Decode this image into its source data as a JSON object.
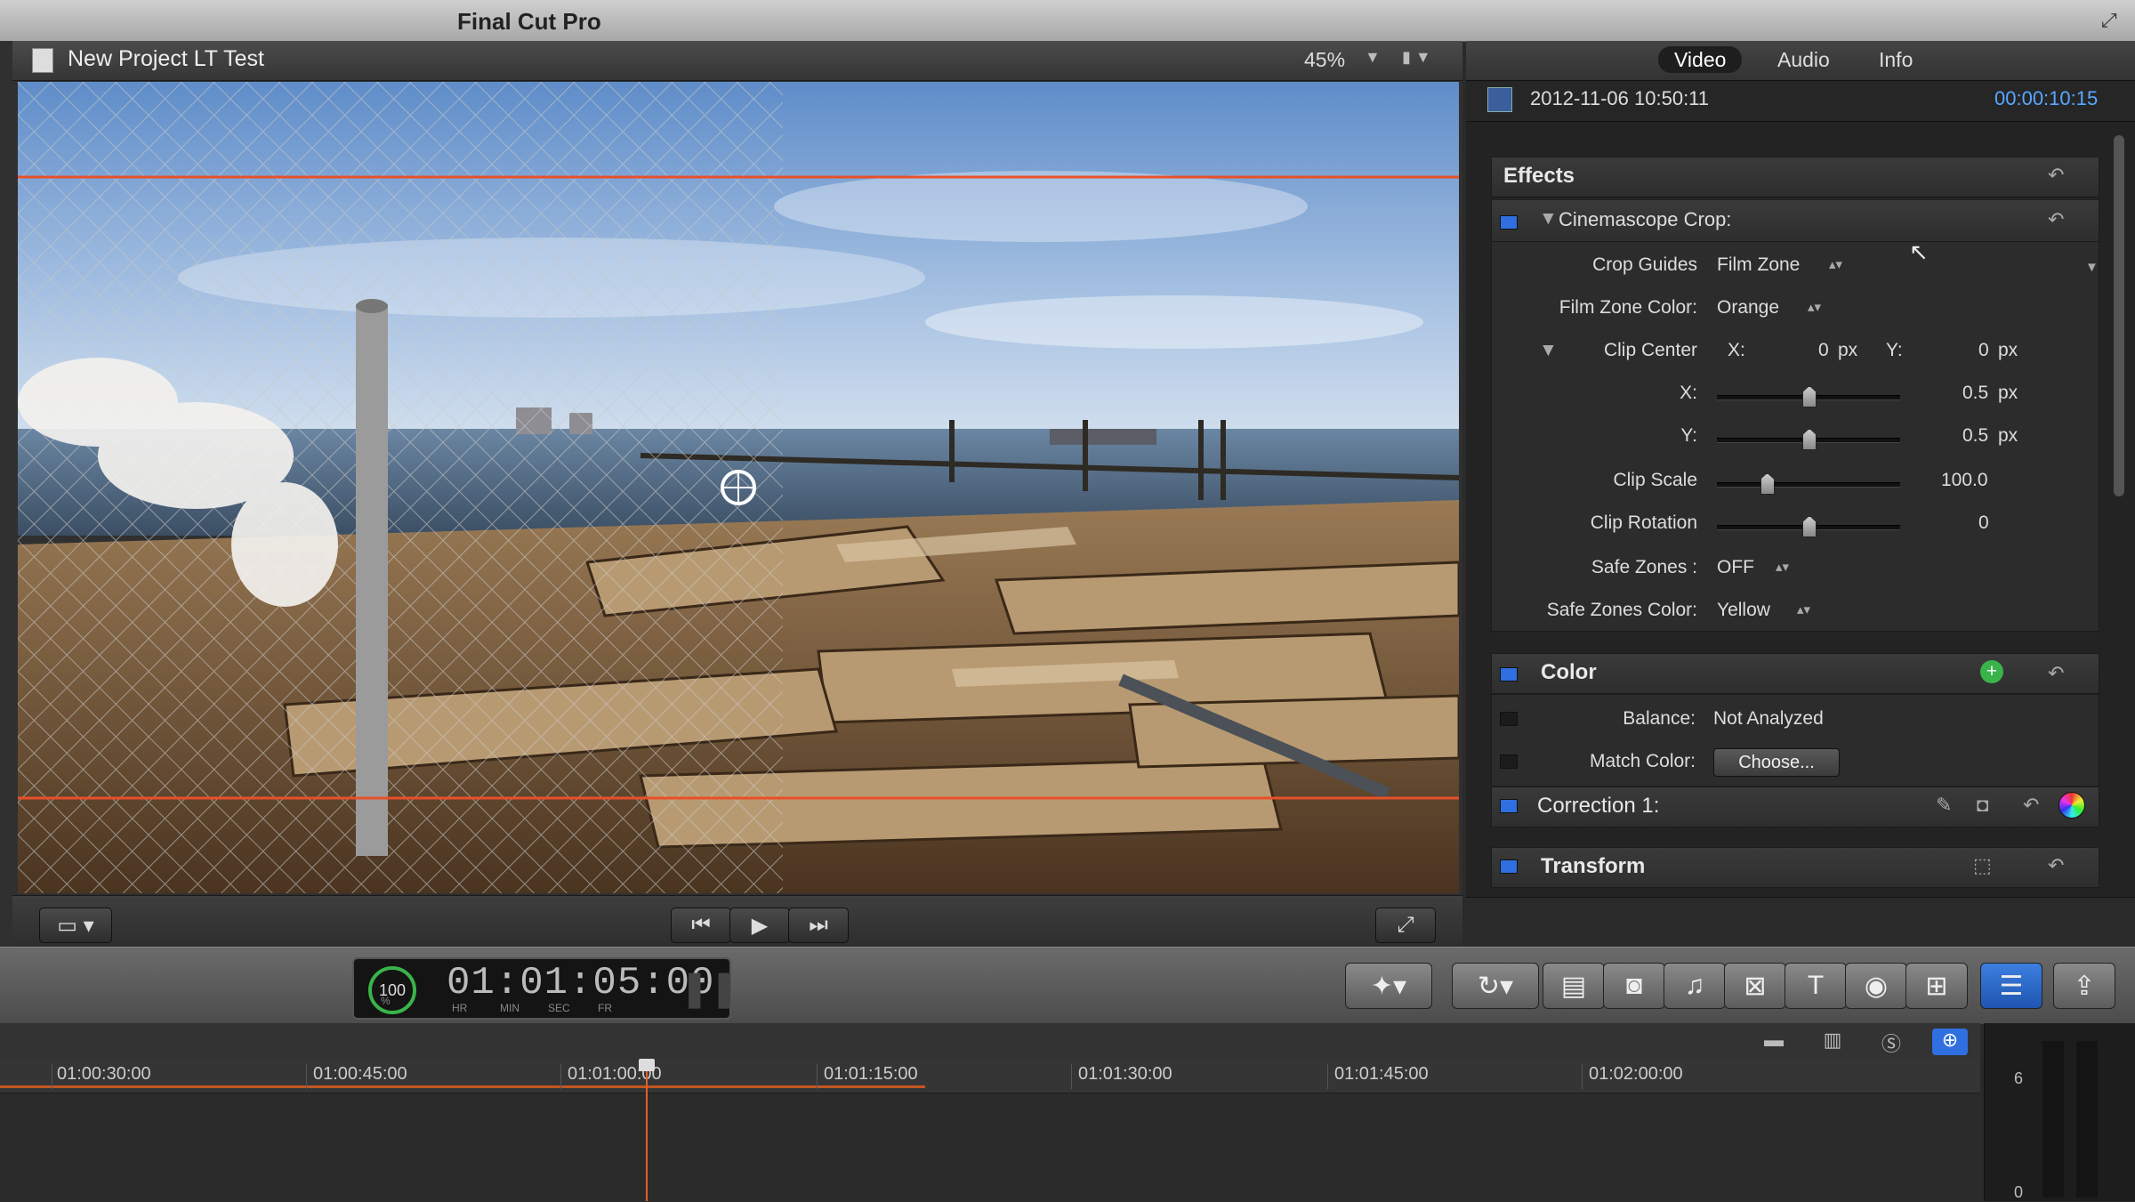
{
  "app": {
    "title": "Final Cut Pro"
  },
  "viewer": {
    "project_title": "New Project LT Test",
    "zoom": "45%"
  },
  "inspector": {
    "tabs": [
      "Video",
      "Audio",
      "Info"
    ],
    "active_tab": "Video",
    "clip_date": "2012-11-06 10:50:11",
    "clip_duration": "00:00:10:15",
    "effects": {
      "title": "Effects",
      "effect_name": "Cinemascope Crop:",
      "params": {
        "crop_guides": {
          "label": "Crop Guides",
          "value": "Film Zone"
        },
        "film_zone_color": {
          "label": "Film Zone Color:",
          "value": "Orange"
        },
        "clip_center": {
          "label": "Clip  Center",
          "x_label": "X:",
          "x_value": "0",
          "x_unit": "px",
          "y_label": "Y:",
          "y_value": "0",
          "y_unit": "px"
        },
        "x": {
          "label": "X:",
          "value": "0.5",
          "unit": "px",
          "level": 0.5
        },
        "y": {
          "label": "Y:",
          "value": "0.5",
          "unit": "px",
          "level": 0.5
        },
        "clip_scale": {
          "label": "Clip Scale",
          "value": "100.0",
          "level": 0.27
        },
        "clip_rotation": {
          "label": "Clip Rotation",
          "value": "0",
          "level": 0.5
        },
        "safe_zones": {
          "label": "Safe Zones :",
          "value": "OFF"
        },
        "safe_zones_color": {
          "label": "Safe Zones Color:",
          "value": "Yellow"
        }
      }
    },
    "color": {
      "title": "Color",
      "balance_label": "Balance:",
      "balance_value": "Not Analyzed",
      "match_color_label": "Match Color:",
      "match_color_button": "Choose...",
      "correction_label": "Correction 1:"
    },
    "transform": {
      "title": "Transform"
    }
  },
  "toolbar": {
    "timecode": "01:01:05:00",
    "timecode_percent": "100",
    "timecode_percent_sign": "%",
    "timecode_units": [
      "HR",
      "MIN",
      "SEC",
      "FR"
    ]
  },
  "timeline": {
    "ruler_labels": [
      "01:00:30:00",
      "01:00:45:00",
      "01:01:00:00",
      "01:01:15:00",
      "01:01:30:00",
      "01:01:45:00",
      "01:02:00:00"
    ]
  },
  "audio_meters": {
    "labels": [
      "6",
      "0"
    ]
  },
  "colors": {
    "accent_blue": "#2f6fe0",
    "film_zone_orange": "#e8502a",
    "timecode_text_blue": "#57a8ff"
  }
}
